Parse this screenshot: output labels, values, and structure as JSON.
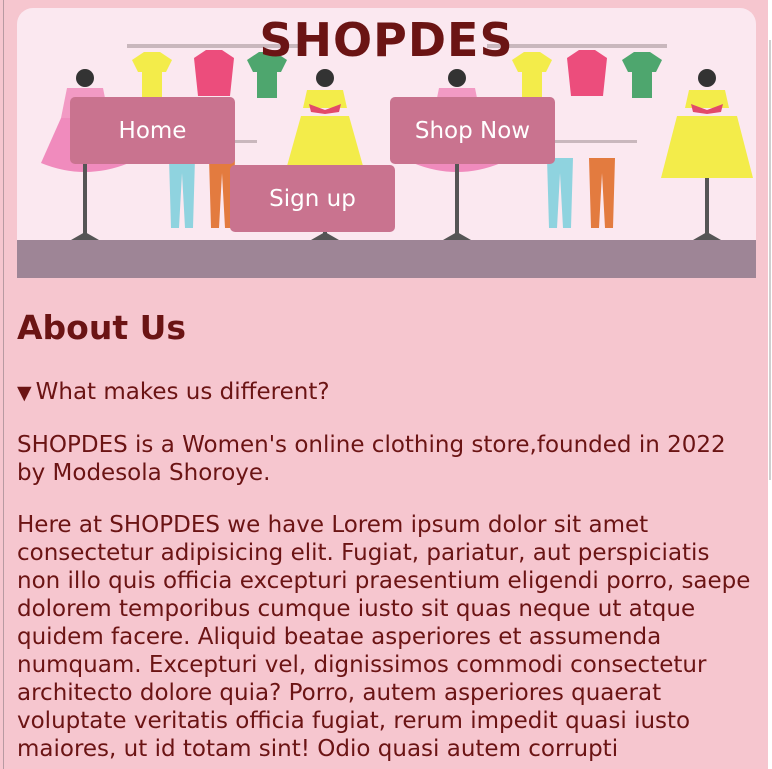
{
  "header": {
    "brand": "SHOPDES",
    "nav": {
      "home": "Home",
      "shop_now": "Shop Now",
      "sign_up": "Sign up"
    },
    "banner_image": "clothing-store-rack-illustration"
  },
  "main": {
    "title": "About Us",
    "details": {
      "summary": "What makes us different?",
      "expanded": true
    },
    "paragraphs": [
      "SHOPDES is a Women's online clothing store,founded in 2022 by Modesola Shoroye.",
      "Here at SHOPDES we have Lorem ipsum dolor sit amet consectetur adipisicing elit. Fugiat, pariatur, aut perspiciatis non illo quis officia excepturi praesentium eligendi porro, saepe dolorem temporibus cumque iusto sit quas neque ut atque quidem facere. Aliquid beatae asperiores et assumenda numquam. Excepturi vel, dignissimos commodi consectetur architecto dolore quia? Porro, autem asperiores quaerat voluptate veritatis officia fugiat, rerum impedit quasi iusto maiores, ut id totam sint! Odio quasi autem corrupti"
    ]
  },
  "colors": {
    "background": "#f6c6cf",
    "text": "#6b1414",
    "button": "#c9738f",
    "banner": "#fbe8f0"
  }
}
